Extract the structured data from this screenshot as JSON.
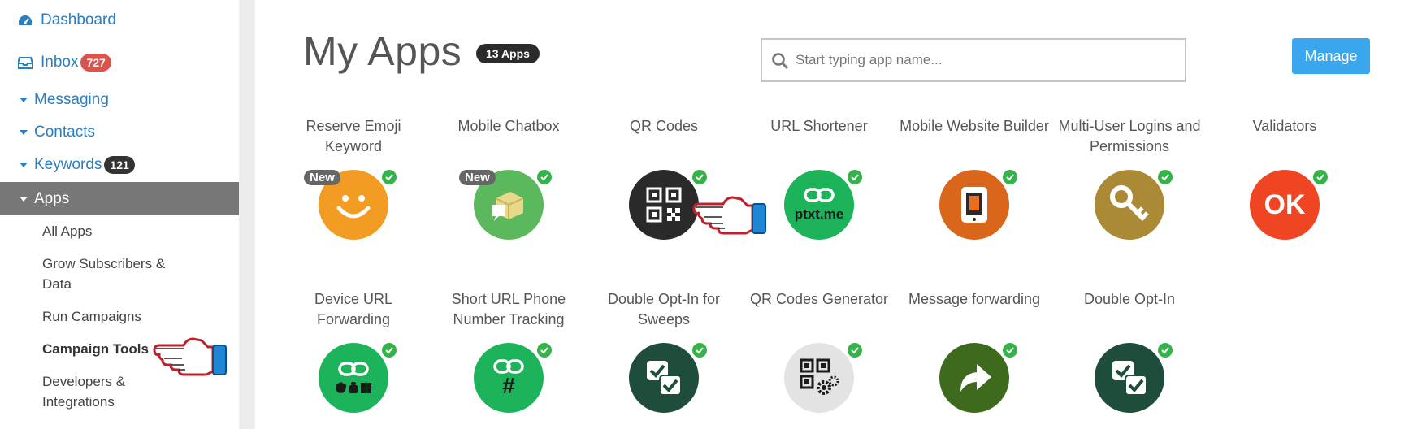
{
  "sidebar": {
    "dashboard": "Dashboard",
    "inbox": {
      "label": "Inbox",
      "count": "727",
      "badge_color": "#d9534f"
    },
    "messaging": "Messaging",
    "contacts": "Contacts",
    "keywords": {
      "label": "Keywords",
      "count": "121",
      "badge_color": "#333333"
    },
    "apps": "Apps",
    "sub_items": [
      "All Apps",
      "Grow Subscribers & Data",
      "Run Campaigns",
      "Campaign Tools",
      "Developers & Integrations"
    ]
  },
  "header": {
    "title": "My Apps",
    "count_badge": "13 Apps",
    "search_placeholder": "Start typing app name...",
    "manage_label": "Manage"
  },
  "apps": [
    {
      "name": "Reserve Emoji Keyword",
      "badge": "New",
      "icon": "smiley-icon",
      "color": "#f39c24"
    },
    {
      "name": "Mobile Chatbox",
      "badge": "New",
      "icon": "chatbox-cube-icon",
      "color": "#5cb85c"
    },
    {
      "name": "QR Codes",
      "icon": "qr-code-icon",
      "color": "#2a2a2a"
    },
    {
      "name": "URL Shortener",
      "icon": "link-icon",
      "icon_text": "ptxt.me",
      "color": "#1cb35a"
    },
    {
      "name": "Mobile Website Builder",
      "icon": "tablet-icon",
      "color": "#d9661b"
    },
    {
      "name": "Multi-User Logins and Permissions",
      "icon": "key-icon",
      "color": "#ab8a35"
    },
    {
      "name": "Validators",
      "icon": "ok-icon",
      "icon_text": "OK",
      "color": "#ef4523"
    },
    {
      "name": "Device URL Forwarding",
      "icon": "device-link-icon",
      "color": "#1cb35a"
    },
    {
      "name": "Short URL Phone Number Tracking",
      "icon": "hash-link-icon",
      "icon_text": "#",
      "color": "#1cb35a"
    },
    {
      "name": "Double Opt-In for Sweeps",
      "icon": "double-check-icon",
      "color": "#1e4d3c"
    },
    {
      "name": "QR Codes Generator",
      "icon": "qr-gears-icon",
      "color": "#e3e3e3"
    },
    {
      "name": "Message forwarding",
      "icon": "forward-arrow-icon",
      "color": "#3e6a1e"
    },
    {
      "name": "Double Opt-In",
      "icon": "double-check-icon",
      "color": "#1e4d3c"
    }
  ],
  "colors": {
    "link": "#2a7dbf",
    "active_bg": "#777777",
    "manage": "#3aa6ee",
    "check": "#35b34a"
  }
}
